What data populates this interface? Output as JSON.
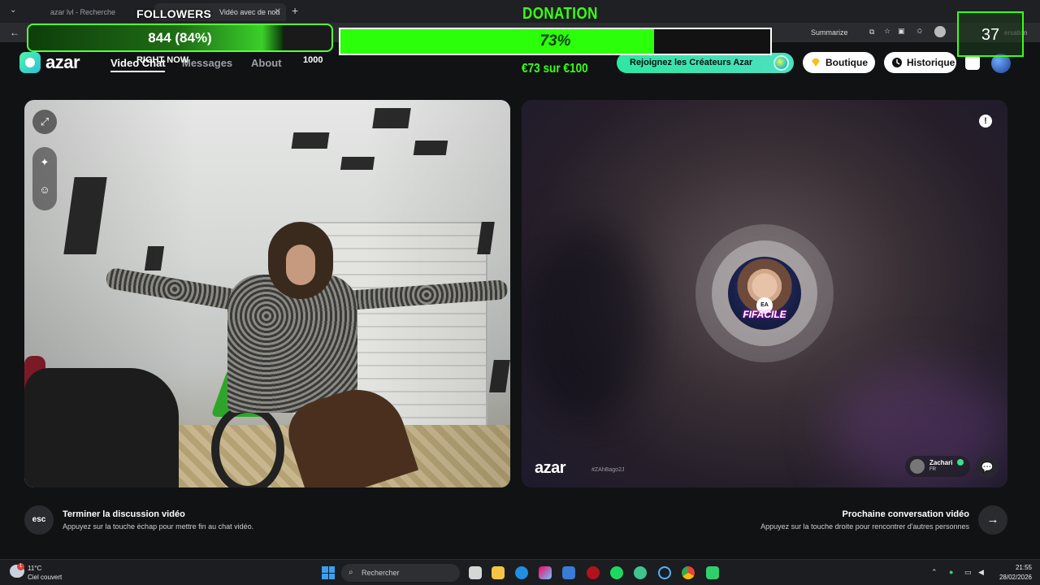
{
  "browser": {
    "tabs": [
      {
        "label": "azar lvl - Recherche"
      },
      {
        "label": "Vidéo avec de nou",
        "active": true
      }
    ],
    "toolbar": {
      "summarize": "Summarize",
      "partial_label": "ersation"
    }
  },
  "overlay": {
    "followers": {
      "title": "FOLLOWERS",
      "text": "844 (84%)",
      "progress": 0.84
    },
    "right_now": {
      "label": "RIGHT NOW",
      "count": "1000"
    },
    "donation": {
      "title": "DONATION",
      "percent_text": "73%",
      "progress": 0.73,
      "sub": "€73 sur €100"
    },
    "counter": {
      "value": "37"
    }
  },
  "azar": {
    "logo": "azar",
    "nav": [
      {
        "label": "Video Chat",
        "active": true
      },
      {
        "label": "Messages"
      },
      {
        "label": "About"
      }
    ],
    "creators_button": "Rejoignez les Créateurs Azar",
    "boutique_button": "Boutique",
    "historique_button": "Historique",
    "remote": {
      "watermark": "azar",
      "handle": "#ZAhBago2J",
      "user_name": "Zachari",
      "user_country": "FR",
      "avatar_text": "FIFACILE"
    },
    "actions": {
      "end": {
        "key": "esc",
        "title": "Terminer la discussion vidéo",
        "sub": "Appuyez sur la touche échap pour mettre fin au chat vidéo."
      },
      "next": {
        "key": "→",
        "title": "Prochaine conversation vidéo",
        "sub": "Appuyez sur la touche droite pour rencontrer d'autres personnes"
      }
    }
  },
  "taskbar": {
    "weather": {
      "temp": "11°C",
      "desc": "Ciel couvert",
      "badge": "1"
    },
    "search_placeholder": "Rechercher",
    "time": "21:55",
    "date": "28/02/2026"
  },
  "colors": {
    "accent_green": "#39ff14",
    "azar_mint": "#2ee6a4"
  }
}
